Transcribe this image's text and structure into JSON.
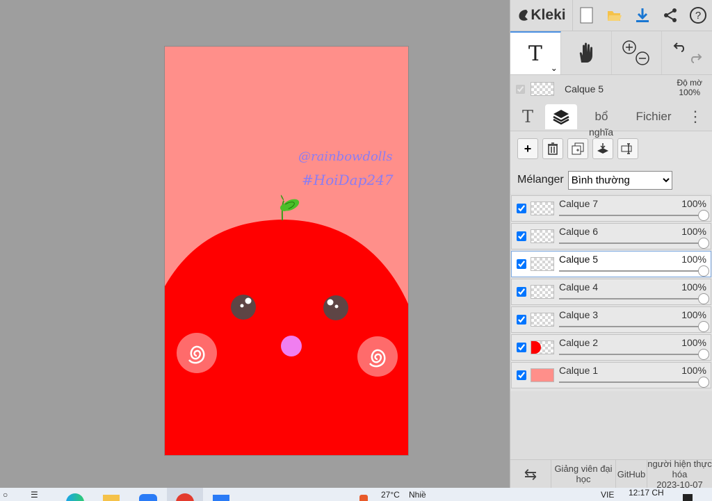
{
  "app": {
    "name": "Kleki"
  },
  "canvas": {
    "watermark_line1": "@rainbowdolls",
    "watermark_line2": "#HoiDap247"
  },
  "toolbar": {
    "icons": [
      "new-file-icon",
      "open-folder-icon",
      "download-icon",
      "share-icon",
      "help-icon"
    ]
  },
  "tools": {
    "text_tool": "T",
    "hand_tool": "hand-icon",
    "zoom": "zoom-icon",
    "undo_redo": "undo-redo-icon"
  },
  "current_layer": {
    "name": "Calque 5",
    "opacity_label": "Độ mờ",
    "opacity_value": "100%"
  },
  "tabs": {
    "text_tab": "T",
    "layers_tab": "layers-icon",
    "more_tab": "bổ",
    "file_tab": "Fichier"
  },
  "layer_tools": {
    "tooltip": "nghĩa",
    "icons": [
      "add-layer-icon",
      "delete-layer-icon",
      "duplicate-layer-icon",
      "merge-layer-icon",
      "rename-layer-icon"
    ]
  },
  "blend": {
    "label": "Mélanger",
    "value": "Bình thường"
  },
  "layers": [
    {
      "name": "Calque 7",
      "opacity": "100%"
    },
    {
      "name": "Calque 6",
      "opacity": "100%"
    },
    {
      "name": "Calque 5",
      "opacity": "100%"
    },
    {
      "name": "Calque 4",
      "opacity": "100%"
    },
    {
      "name": "Calque 3",
      "opacity": "100%"
    },
    {
      "name": "Calque 2",
      "opacity": "100%"
    },
    {
      "name": "Calque 1",
      "opacity": "100%"
    }
  ],
  "footer": {
    "swap_icon": "swap-icon",
    "teacher": "Giảng viên đại học",
    "github": "GitHub",
    "realized_by": "người hiện thực hóa",
    "date": "2023-10-07"
  },
  "taskbar": {
    "weather": "27°C",
    "weather_text": "Nhiề",
    "lang": "VIE",
    "time": "12:17 CH"
  },
  "colors": {
    "canvas_bg": "#ff8f8a",
    "apple_red": "#ff0000",
    "accent": "#4a90e2"
  }
}
